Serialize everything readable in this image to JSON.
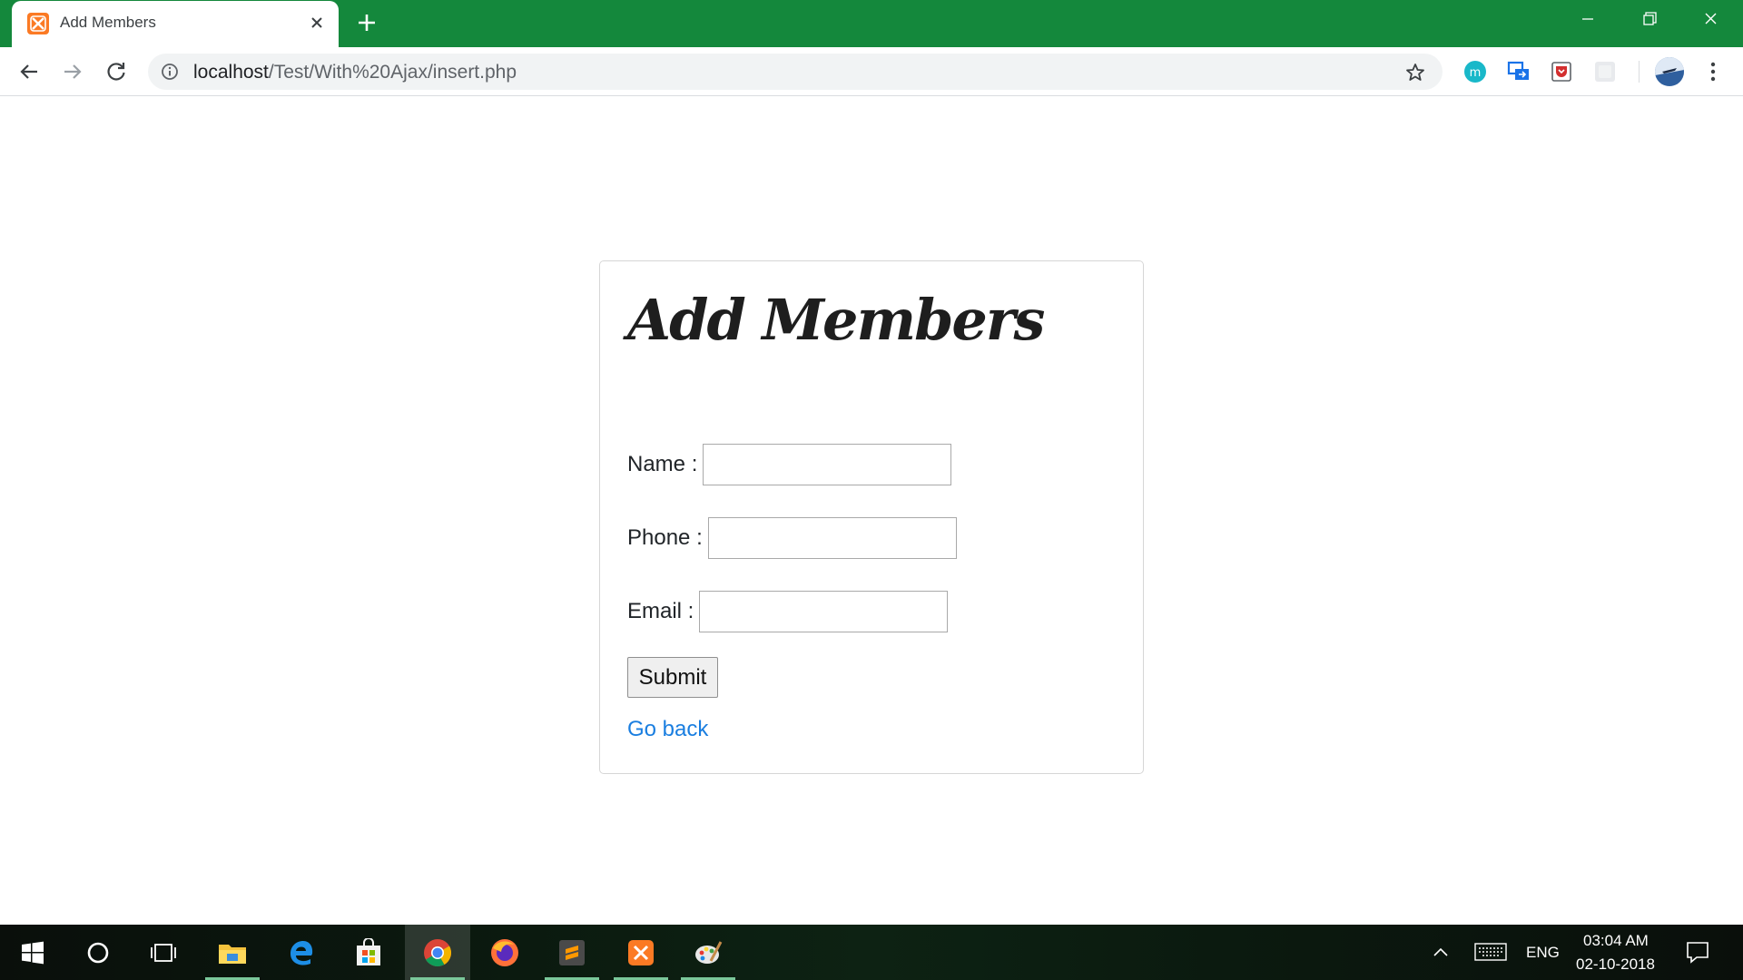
{
  "browser": {
    "tab_title": "Add Members",
    "url_host": "localhost",
    "url_path": "/Test/With%20Ajax/insert.php",
    "theme_color": "#14883c"
  },
  "page": {
    "title": "Add Members",
    "fields": [
      {
        "label": "Name :",
        "value": ""
      },
      {
        "label": "Phone :",
        "value": ""
      },
      {
        "label": "Email :",
        "value": ""
      }
    ],
    "submit_label": "Submit",
    "back_link": "Go back",
    "link_color": "#1a7ee0"
  },
  "taskbar": {
    "apps": [
      "windows-start-icon",
      "cortana-icon",
      "task-view-icon",
      "file-explorer-icon",
      "edge-icon",
      "store-icon",
      "chrome-icon",
      "firefox-icon",
      "sublime-text-icon",
      "xampp-icon",
      "paint-icon"
    ],
    "active_app": "chrome-icon",
    "language": "ENG",
    "time": "03:04 AM",
    "date": "02-10-2018"
  }
}
